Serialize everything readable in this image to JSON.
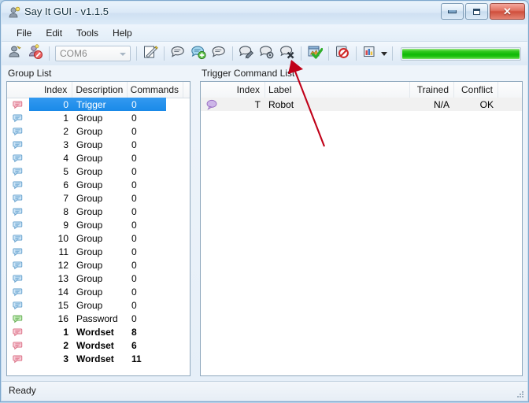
{
  "window": {
    "title": "Say It GUI - v1.1.5",
    "icon": "app-icon",
    "controls": {
      "minimize": "Minimize",
      "maximize": "Maximize",
      "close": "Close"
    }
  },
  "menubar": {
    "items": [
      "File",
      "Edit",
      "Tools",
      "Help"
    ]
  },
  "toolbar": {
    "buttons": [
      {
        "name": "connect-icon",
        "title": "Connect"
      },
      {
        "name": "disconnect-icon",
        "title": "Disconnect"
      }
    ],
    "port_combo": {
      "value": "COM6",
      "placeholder": "COM6"
    },
    "buttons2": [
      {
        "name": "edit-note-icon",
        "title": "Edit"
      }
    ],
    "buttons3": [
      {
        "name": "speech-bubble-icon",
        "title": "Command"
      },
      {
        "name": "speech-bubble-add-icon",
        "title": "Add Command"
      },
      {
        "name": "speech-bubble-plain-icon",
        "title": "Command Properties"
      }
    ],
    "buttons4": [
      {
        "name": "speech-bubble-train-icon",
        "title": "Train"
      },
      {
        "name": "speech-bubble-settings-icon",
        "title": "Settings"
      },
      {
        "name": "speech-bubble-delete-icon",
        "title": "Delete"
      }
    ],
    "buttons5": [
      {
        "name": "apply-check-icon",
        "title": "Apply"
      }
    ],
    "buttons6": [
      {
        "name": "block-icon",
        "title": "Stop"
      }
    ],
    "buttons7": [
      {
        "name": "chart-icon",
        "title": "View"
      }
    ],
    "progress": {
      "value": 100,
      "color": "#10b806"
    }
  },
  "group_panel": {
    "title": "Group List",
    "columns": [
      "Index",
      "Description",
      "Commands"
    ],
    "rows": [
      {
        "icon": "speech-bubble-icon",
        "icon_color": "pink",
        "index": "0",
        "description": "Trigger",
        "commands": "0",
        "selected": true,
        "bold": false
      },
      {
        "icon": "speech-bubble-icon",
        "icon_color": "blue",
        "index": "1",
        "description": "Group",
        "commands": "0",
        "selected": false,
        "bold": false
      },
      {
        "icon": "speech-bubble-icon",
        "icon_color": "blue",
        "index": "2",
        "description": "Group",
        "commands": "0",
        "selected": false,
        "bold": false
      },
      {
        "icon": "speech-bubble-icon",
        "icon_color": "blue",
        "index": "3",
        "description": "Group",
        "commands": "0",
        "selected": false,
        "bold": false
      },
      {
        "icon": "speech-bubble-icon",
        "icon_color": "blue",
        "index": "4",
        "description": "Group",
        "commands": "0",
        "selected": false,
        "bold": false
      },
      {
        "icon": "speech-bubble-icon",
        "icon_color": "blue",
        "index": "5",
        "description": "Group",
        "commands": "0",
        "selected": false,
        "bold": false
      },
      {
        "icon": "speech-bubble-icon",
        "icon_color": "blue",
        "index": "6",
        "description": "Group",
        "commands": "0",
        "selected": false,
        "bold": false
      },
      {
        "icon": "speech-bubble-icon",
        "icon_color": "blue",
        "index": "7",
        "description": "Group",
        "commands": "0",
        "selected": false,
        "bold": false
      },
      {
        "icon": "speech-bubble-icon",
        "icon_color": "blue",
        "index": "8",
        "description": "Group",
        "commands": "0",
        "selected": false,
        "bold": false
      },
      {
        "icon": "speech-bubble-icon",
        "icon_color": "blue",
        "index": "9",
        "description": "Group",
        "commands": "0",
        "selected": false,
        "bold": false
      },
      {
        "icon": "speech-bubble-icon",
        "icon_color": "blue",
        "index": "10",
        "description": "Group",
        "commands": "0",
        "selected": false,
        "bold": false
      },
      {
        "icon": "speech-bubble-icon",
        "icon_color": "blue",
        "index": "11",
        "description": "Group",
        "commands": "0",
        "selected": false,
        "bold": false
      },
      {
        "icon": "speech-bubble-icon",
        "icon_color": "blue",
        "index": "12",
        "description": "Group",
        "commands": "0",
        "selected": false,
        "bold": false
      },
      {
        "icon": "speech-bubble-icon",
        "icon_color": "blue",
        "index": "13",
        "description": "Group",
        "commands": "0",
        "selected": false,
        "bold": false
      },
      {
        "icon": "speech-bubble-icon",
        "icon_color": "blue",
        "index": "14",
        "description": "Group",
        "commands": "0",
        "selected": false,
        "bold": false
      },
      {
        "icon": "speech-bubble-icon",
        "icon_color": "blue",
        "index": "15",
        "description": "Group",
        "commands": "0",
        "selected": false,
        "bold": false
      },
      {
        "icon": "speech-bubble-icon",
        "icon_color": "green",
        "index": "16",
        "description": "Password",
        "commands": "0",
        "selected": false,
        "bold": false
      },
      {
        "icon": "speech-bubble-icon",
        "icon_color": "pink",
        "index": "1",
        "description": "Wordset",
        "commands": "8",
        "selected": false,
        "bold": true
      },
      {
        "icon": "speech-bubble-icon",
        "icon_color": "pink",
        "index": "2",
        "description": "Wordset",
        "commands": "6",
        "selected": false,
        "bold": true
      },
      {
        "icon": "speech-bubble-icon",
        "icon_color": "pink",
        "index": "3",
        "description": "Wordset",
        "commands": "11",
        "selected": false,
        "bold": true
      }
    ]
  },
  "trigger_panel": {
    "title": "Trigger Command List",
    "columns": [
      "Index",
      "Label",
      "Trained",
      "Conflict"
    ],
    "rows": [
      {
        "icon": "speech-bubble-icon",
        "icon_color": "violet",
        "index": "T",
        "label": "Robot",
        "trained": "N/A",
        "conflict": "OK"
      }
    ]
  },
  "statusbar": {
    "text": "Ready"
  },
  "annotation": {
    "type": "arrow",
    "color": "#c00018",
    "points": "points at apply-check-icon in toolbar"
  }
}
